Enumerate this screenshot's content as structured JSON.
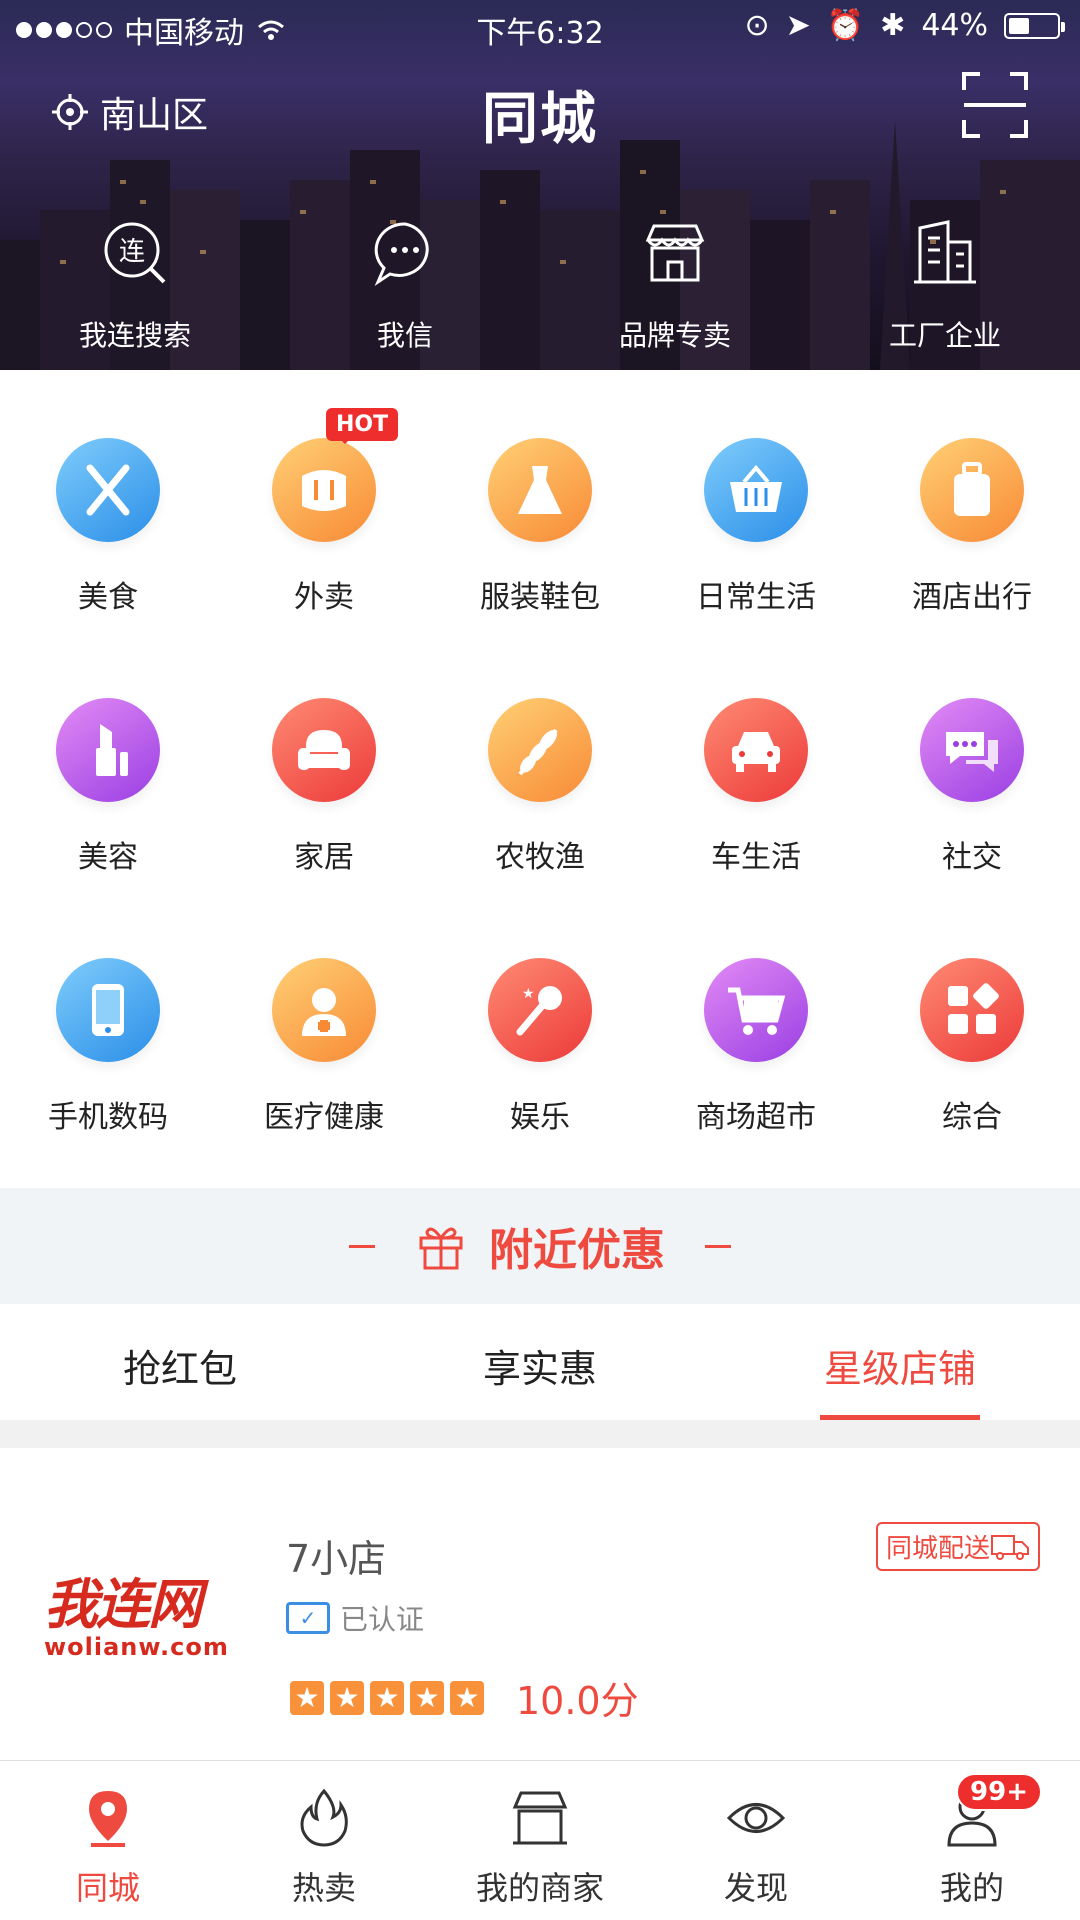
{
  "status_bar": {
    "carrier": "中国移动",
    "time": "下午6:32",
    "battery": "44%",
    "battery_level": 0.44
  },
  "header": {
    "location": "南山区",
    "brand": "同城",
    "icons": [
      "location-icon",
      "scan-icon"
    ]
  },
  "quick_links": [
    {
      "label": "我连搜索",
      "icon": "search-lian-icon"
    },
    {
      "label": "我信",
      "icon": "chat-bubble-icon"
    },
    {
      "label": "品牌专卖",
      "icon": "store-icon"
    },
    {
      "label": "工厂企业",
      "icon": "building-icon"
    }
  ],
  "categories": [
    {
      "label": "美食",
      "icon": "fork-knife-icon",
      "color": "#2b8ee8"
    },
    {
      "label": "外卖",
      "icon": "takeout-icon",
      "color": "#f88a36",
      "badge": "HOT"
    },
    {
      "label": "服装鞋包",
      "icon": "dress-icon",
      "color": "#f88a36"
    },
    {
      "label": "日常生活",
      "icon": "basket-icon",
      "color": "#2b8ee8"
    },
    {
      "label": "酒店出行",
      "icon": "luggage-icon",
      "color": "#f88a36"
    },
    {
      "label": "美容",
      "icon": "lipstick-icon",
      "color": "#9a3fe3"
    },
    {
      "label": "家居",
      "icon": "sofa-icon",
      "color": "#ec3a3a"
    },
    {
      "label": "农牧渔",
      "icon": "wheat-icon",
      "color": "#f88a36"
    },
    {
      "label": "车生活",
      "icon": "car-icon",
      "color": "#ec3a3a"
    },
    {
      "label": "社交",
      "icon": "chat-icon",
      "color": "#9a3fe3"
    },
    {
      "label": "手机数码",
      "icon": "phone-icon",
      "color": "#2b8ee8"
    },
    {
      "label": "医疗健康",
      "icon": "doctor-icon",
      "color": "#f88a36"
    },
    {
      "label": "娱乐",
      "icon": "microphone-icon",
      "color": "#ec3a3a"
    },
    {
      "label": "商场超市",
      "icon": "cart-icon",
      "color": "#9a3fe3"
    },
    {
      "label": "综合",
      "icon": "grid-icon",
      "color": "#ec3a3a"
    }
  ],
  "nearby": {
    "title": "附近优惠",
    "icon": "gift-icon"
  },
  "tabs": [
    {
      "label": "抢红包",
      "active": false
    },
    {
      "label": "享实惠",
      "active": false
    },
    {
      "label": "星级店铺",
      "active": true
    }
  ],
  "shop": {
    "logo_text": "我连网",
    "logo_url": "wolianw.com",
    "name": "7小店",
    "delivery": "同城配送",
    "certified": "已认证",
    "stars": 5,
    "score": "10.0分"
  },
  "tab_bar": [
    {
      "label": "同城",
      "icon": "location-pin-icon",
      "active": true
    },
    {
      "label": "热卖",
      "icon": "flame-icon",
      "active": false
    },
    {
      "label": "我的商家",
      "icon": "shop-icon",
      "active": false
    },
    {
      "label": "发现",
      "icon": "eye-icon",
      "active": false
    },
    {
      "label": "我的",
      "icon": "user-icon",
      "active": false,
      "badge": "99+"
    }
  ],
  "colors": {
    "accent": "#ee4a3f",
    "hero_bg": "#2b2a55"
  }
}
